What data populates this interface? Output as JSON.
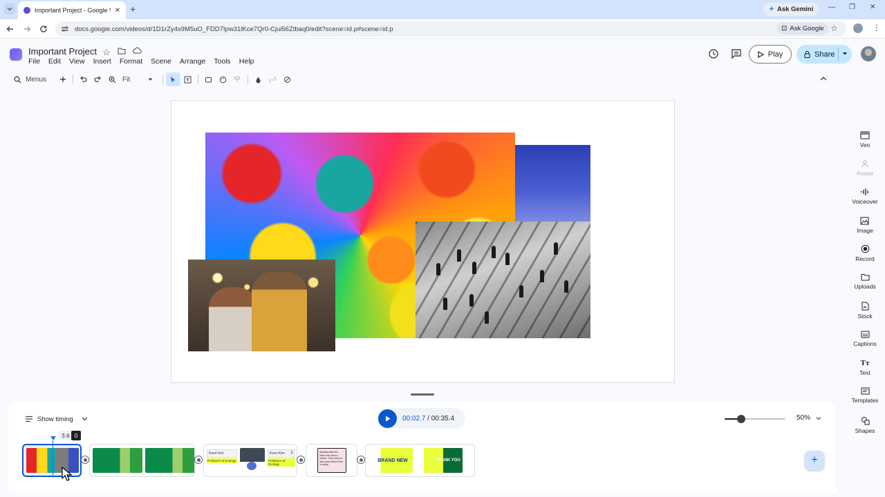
{
  "browser": {
    "tab_title": "Important Project - Google Vid",
    "ask_gemini": "Ask Gemini",
    "url": "docs.google.com/videos/d/1D1rZy4s9M5uO_FDD7Ipw31lKce7Qr0-Cjui56Ztbaq0/edit?scene=id.p#scene=id.p",
    "ask_google": "Ask Google"
  },
  "app": {
    "title": "Important Project",
    "menus": [
      "File",
      "Edit",
      "View",
      "Insert",
      "Format",
      "Scene",
      "Arrange",
      "Tools",
      "Help"
    ],
    "play_label": "Play",
    "share_label": "Share"
  },
  "toolbar": {
    "search_label": "Menus",
    "zoom_value": "Fit"
  },
  "rail": {
    "items": [
      {
        "label": "Veo",
        "icon": "veo-icon",
        "enabled": true
      },
      {
        "label": "Avatar",
        "icon": "avatar-icon",
        "enabled": false
      },
      {
        "label": "Voiceover",
        "icon": "voiceover-icon",
        "enabled": true
      },
      {
        "label": "Image",
        "icon": "image-icon",
        "enabled": true
      },
      {
        "label": "Record",
        "icon": "record-icon",
        "enabled": true
      },
      {
        "label": "Uploads",
        "icon": "folder-icon",
        "enabled": true
      },
      {
        "label": "Stock",
        "icon": "stock-icon",
        "enabled": true
      },
      {
        "label": "Captions",
        "icon": "captions-icon",
        "enabled": true
      },
      {
        "label": "Text",
        "icon": "text-icon",
        "enabled": true
      },
      {
        "label": "Templates",
        "icon": "templates-icon",
        "enabled": true
      },
      {
        "label": "Shapes",
        "icon": "shapes-icon",
        "enabled": true
      }
    ]
  },
  "timeline": {
    "show_timing": "Show timing",
    "current_time": "00:02.7",
    "total_time": " / 00:35.4",
    "zoom_pct": "50%",
    "scene_duration": "3.6",
    "scene_duration_suffix": "0",
    "scene2_card_name": "Keeri Kim",
    "scene2_card_role": "Professor of Ecology",
    "scene2_badge": "1",
    "scene3_quote": "Working with this team has been a dream. They took an idea and turned it into a reality.",
    "scene4_brand": "BRAND NEW",
    "scene4_thanks": "THANK YOU"
  },
  "colors": {
    "accent": "#0b57d0",
    "share_bg": "#c2e7ff",
    "tab_strip": "#d3e3fd"
  }
}
